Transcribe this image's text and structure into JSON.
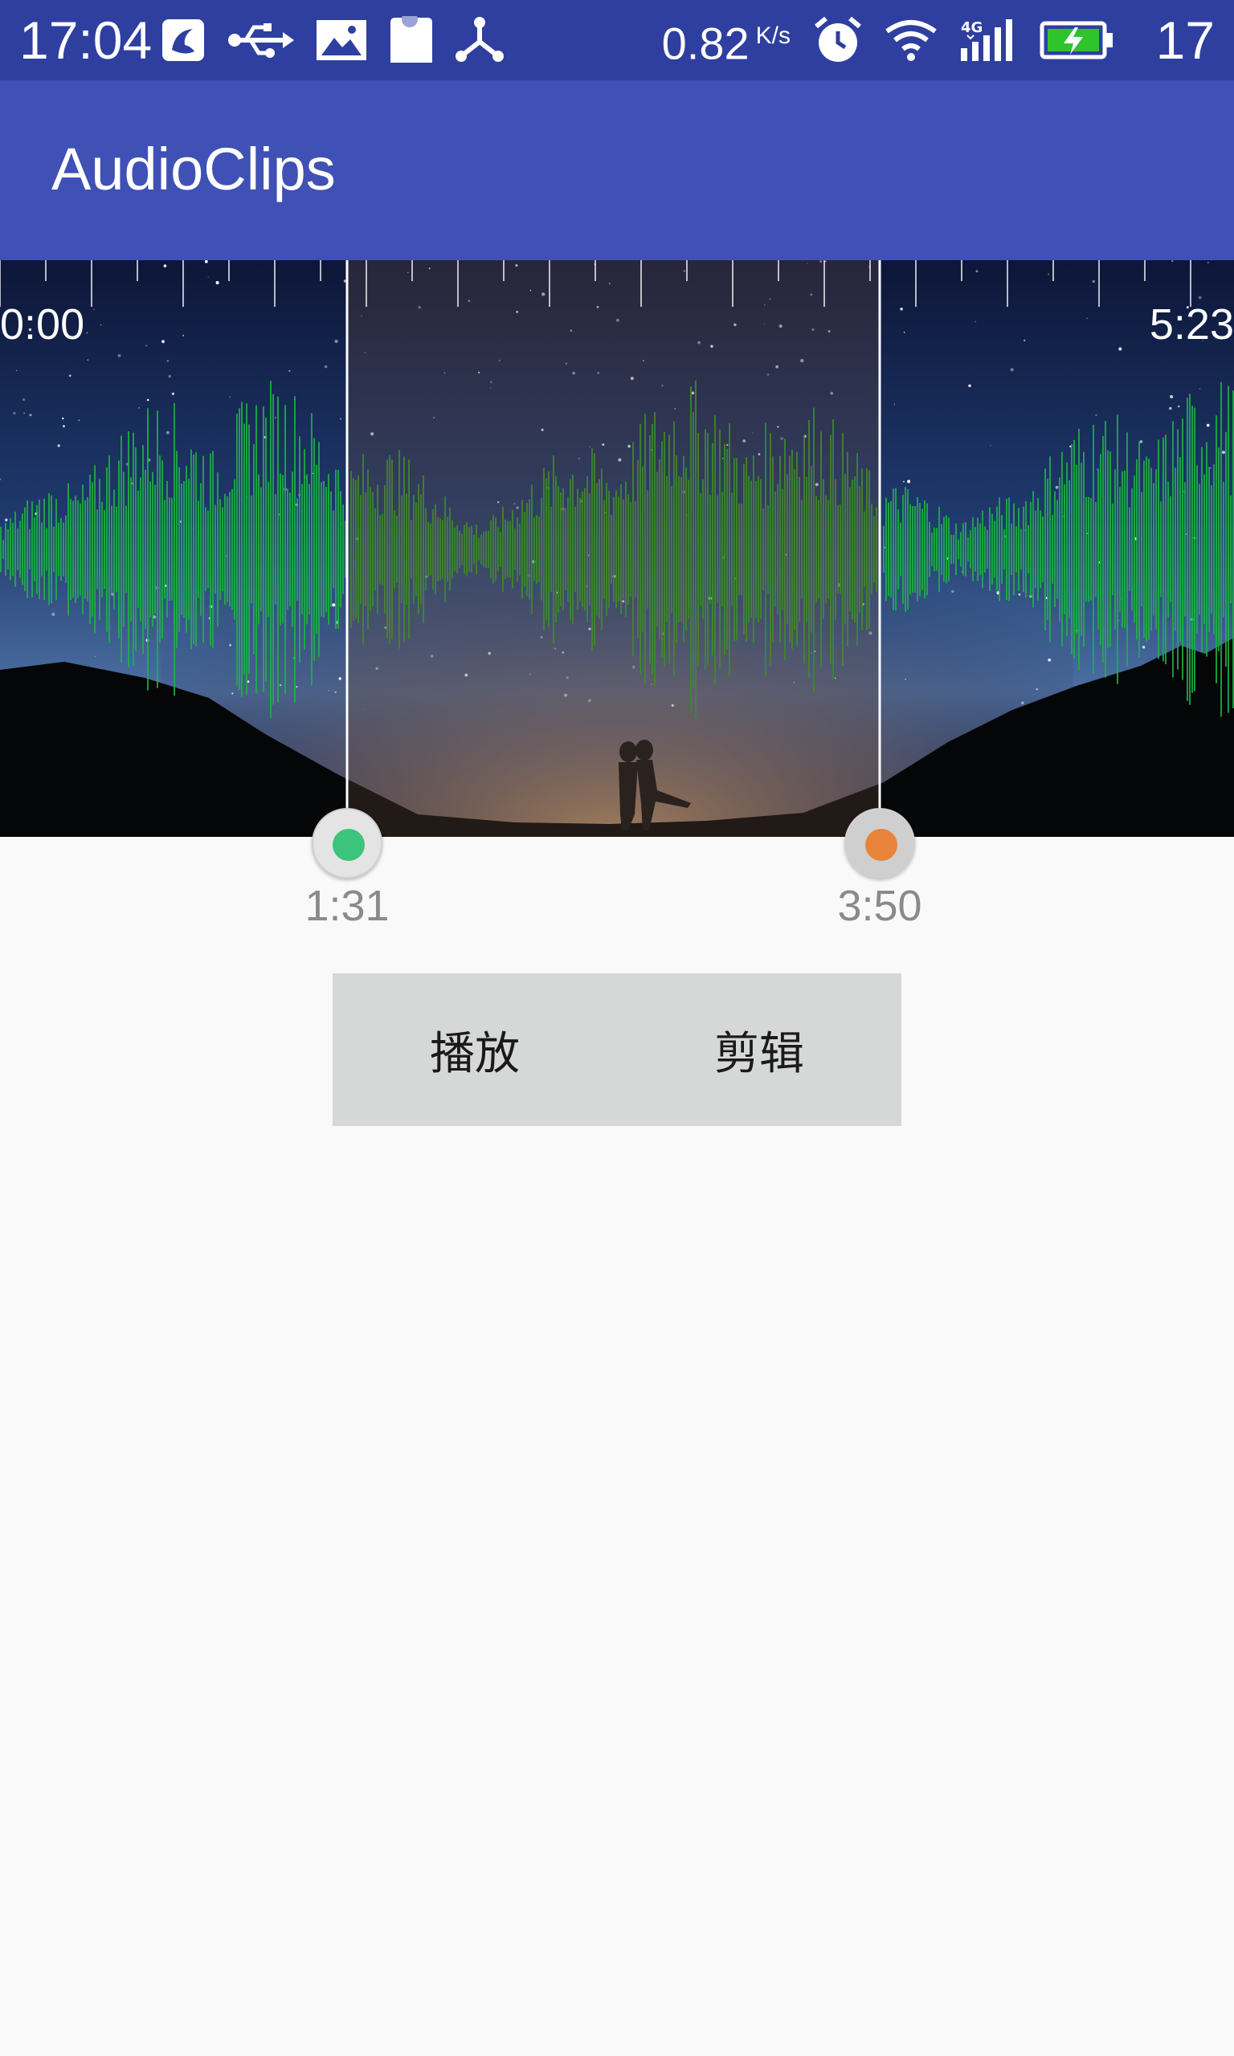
{
  "status_bar": {
    "time": "17:04",
    "net_speed": "0.82",
    "net_speed_unit": "K/s",
    "battery_level": "17",
    "icons_left": [
      "uc-browser-icon",
      "usb-icon",
      "image-icon",
      "sd-card-icon",
      "share-hub-icon"
    ],
    "icons_right": [
      "alarm-icon",
      "wifi-icon",
      "signal-4g-icon",
      "battery-charging-icon"
    ]
  },
  "app_bar": {
    "title": "AudioClips"
  },
  "waveform": {
    "start_time": "0:00",
    "end_time": "5:23",
    "selection_start": {
      "time": "1:31",
      "color": "#3cc47c"
    },
    "selection_end": {
      "time": "3:50",
      "color": "#e8843a"
    },
    "waveform_color": "#1db344",
    "selected_waveform_color": "#3f8a2c"
  },
  "actions": {
    "play_label": "播放",
    "clip_label": "剪辑"
  },
  "colors": {
    "status_bar": "#2f3f9f",
    "app_bar": "#3f51b5",
    "background": "#f9f9f9",
    "button_bar": "#d6d7d7"
  }
}
